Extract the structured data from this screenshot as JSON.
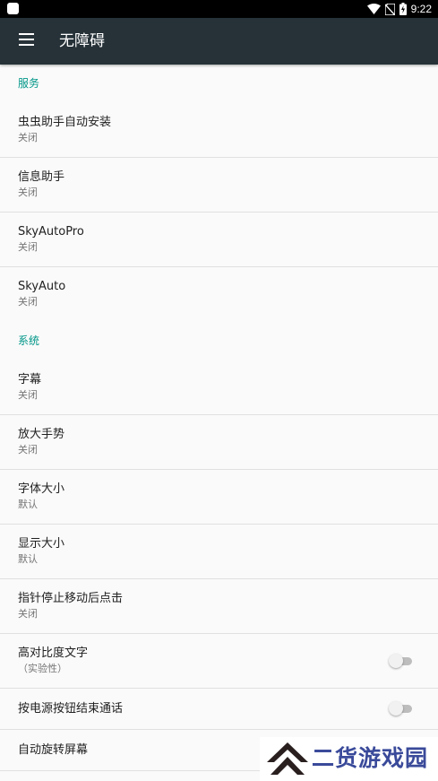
{
  "status_bar": {
    "time": "9:22"
  },
  "toolbar": {
    "title": "无障碍",
    "menu_icon": "hamburger-menu-icon"
  },
  "sections": {
    "services": {
      "header": "服务",
      "items": [
        {
          "title": "虫虫助手自动安装",
          "summary": "关闭"
        },
        {
          "title": "信息助手",
          "summary": "关闭"
        },
        {
          "title": "SkyAutoPro",
          "summary": "关闭"
        },
        {
          "title": "SkyAuto",
          "summary": "关闭"
        }
      ]
    },
    "system": {
      "header": "系统",
      "items": [
        {
          "title": "字幕",
          "summary": "关闭"
        },
        {
          "title": "放大手势",
          "summary": "关闭"
        },
        {
          "title": "字体大小",
          "summary": "默认"
        },
        {
          "title": "显示大小",
          "summary": "默认"
        },
        {
          "title": "指针停止移动后点击",
          "summary": "关闭"
        },
        {
          "title": "高对比度文字",
          "summary": "（实验性）",
          "toggle": false
        },
        {
          "title": "按电源按钮结束通话",
          "toggle": false
        },
        {
          "title": "自动旋转屏幕"
        }
      ]
    }
  },
  "watermark": {
    "text": "二货游戏园"
  },
  "colors": {
    "toolbar": "#263238",
    "accent": "#009688",
    "background": "#fafafa"
  }
}
